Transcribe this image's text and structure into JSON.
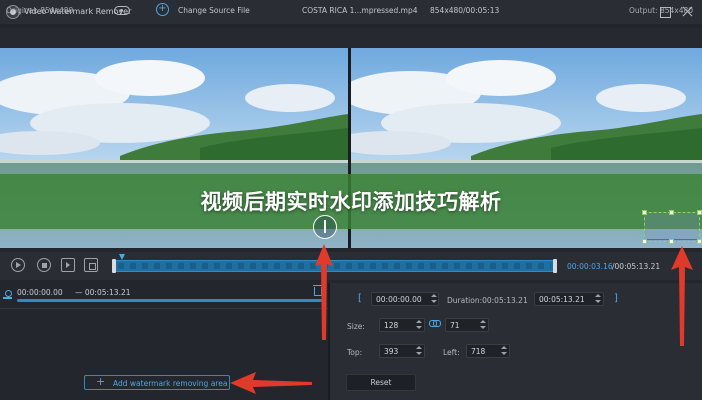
{
  "app": {
    "title": "Video Watermark Remover"
  },
  "topbar": {
    "original_label": "Original: 854x480",
    "change_source_label": "Change Source File",
    "file_name": "COSTA RICA 1...mpressed.mp4",
    "file_info": "854x480/00:05:13",
    "output_label": "Output: 854x480"
  },
  "banner": {
    "title": "视频后期实时水印添加技巧解析"
  },
  "timeline": {
    "current_time": "00:00:03.16",
    "total_time": "/00:05:13.21"
  },
  "segment": {
    "start": "00:00:00.00",
    "end": "— 00:05:13.21"
  },
  "left_panel": {
    "add_area_label": "Add watermark removing area"
  },
  "right_panel": {
    "start_time": "00:00:00.00",
    "duration_label": "Duration:00:05:13.21",
    "end_time": "00:05:13.21",
    "bracket_open": "[",
    "bracket_close": "]",
    "size_label": "Size:",
    "width_value": "128",
    "height_value": "71",
    "top_label": "Top:",
    "top_value": "393",
    "left_label": "Left:",
    "left_value": "718",
    "reset_label": "Reset"
  },
  "icons": [
    "app-logo-icon",
    "eye-icon",
    "add-circle-icon",
    "maximize-icon",
    "close-icon",
    "compare-icon",
    "play-icon",
    "stop-icon",
    "prev-frame-icon",
    "next-frame-icon",
    "segment-icon",
    "trash-icon",
    "plus-icon",
    "link-icon",
    "arrow-icon"
  ],
  "colors": {
    "accent": "#4aa9e8",
    "banner_green": "#3a8234",
    "arrow_red": "#e03a2a",
    "background": "#23262c"
  }
}
